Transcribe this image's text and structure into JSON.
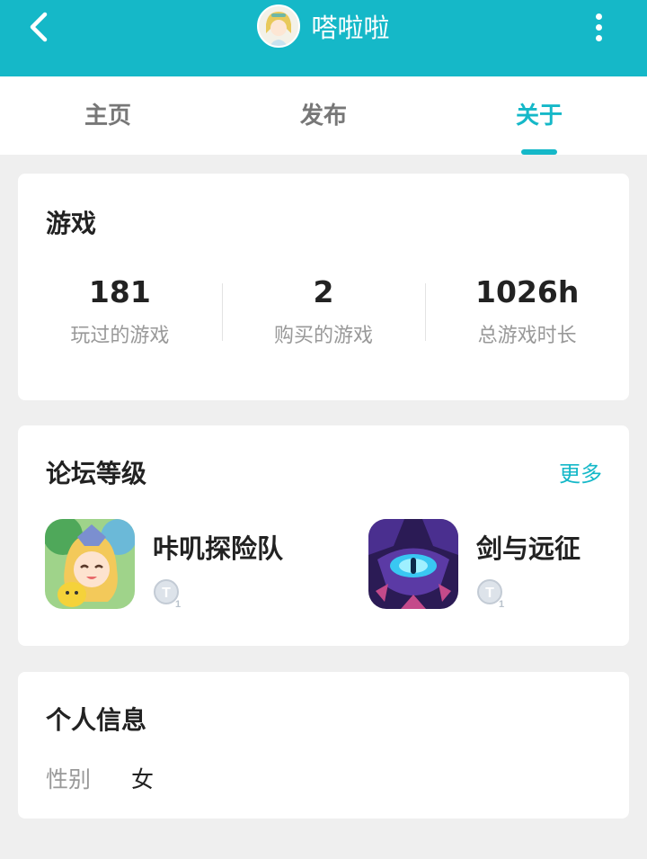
{
  "header": {
    "title": "嗒啦啦",
    "back_icon": "chevron-left-icon",
    "more_icon": "vertical-dots-icon",
    "bg_color": "#15b8c8"
  },
  "tabs": [
    {
      "label": "主页",
      "active": false
    },
    {
      "label": "发布",
      "active": false
    },
    {
      "label": "关于",
      "active": true
    }
  ],
  "games": {
    "title": "游戏",
    "stats": [
      {
        "value": "181",
        "label": "玩过的游戏"
      },
      {
        "value": "2",
        "label": "购买的游戏"
      },
      {
        "value": "1026h",
        "label": "总游戏时长"
      }
    ]
  },
  "forum": {
    "title": "论坛等级",
    "more_label": "更多",
    "items": [
      {
        "name": "咔叽探险队",
        "level_badge": "T",
        "level": "1"
      },
      {
        "name": "剑与远征",
        "level_badge": "T",
        "level": "1"
      }
    ]
  },
  "profile": {
    "title": "个人信息",
    "rows": [
      {
        "label": "性别",
        "value": "女"
      }
    ]
  }
}
